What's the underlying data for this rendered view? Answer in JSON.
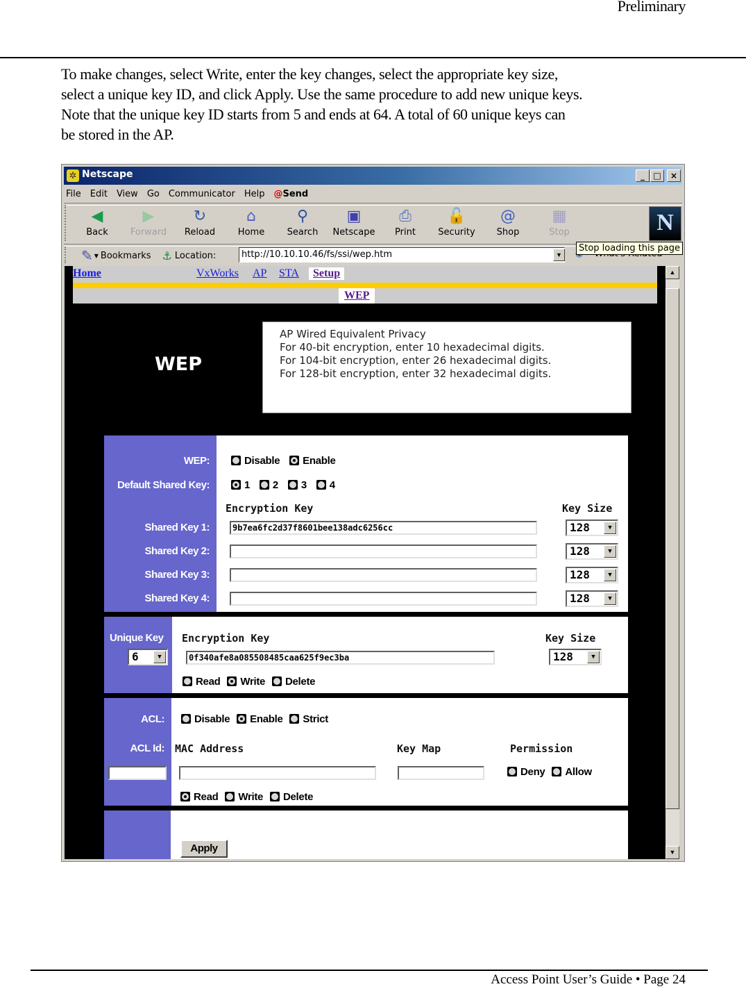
{
  "page_header": {
    "label": "Preliminary"
  },
  "intro": {
    "lines": [
      "To make changes, select Write, enter the key changes, select the appropriate key size,",
      "select a unique key ID, and click Apply. Use the same procedure to add new unique keys.",
      "Note that the unique key ID starts from 5 and ends at 64.  A total of 60 unique keys can",
      "be stored in the AP."
    ]
  },
  "browser": {
    "title": "Netscape",
    "window_controls": {
      "minimize": "_",
      "maximize": "□",
      "close": "×"
    },
    "menu": [
      "File",
      "Edit",
      "View",
      "Go",
      "Communicator",
      "Help"
    ],
    "send_label": "Send",
    "toolbar": [
      {
        "label": "Back",
        "icon": "back-icon",
        "glyph": "◀",
        "color": "#1a9a4a",
        "disabled": false
      },
      {
        "label": "Forward",
        "icon": "forward-icon",
        "glyph": "▶",
        "color": "#9ac8a0",
        "disabled": true
      },
      {
        "label": "Reload",
        "icon": "reload-icon",
        "glyph": "↻",
        "color": "#3a5aa0",
        "disabled": false
      },
      {
        "label": "Home",
        "icon": "home-icon",
        "glyph": "⌂",
        "color": "#5060c0",
        "disabled": false
      },
      {
        "label": "Search",
        "icon": "search-icon",
        "glyph": "⚲",
        "color": "#3050a0",
        "disabled": false
      },
      {
        "label": "Netscape",
        "icon": "my-netscape-icon",
        "glyph": "▣",
        "color": "#4040b0",
        "disabled": false
      },
      {
        "label": "Print",
        "icon": "print-icon",
        "glyph": "⎙",
        "color": "#5070c0",
        "disabled": false
      },
      {
        "label": "Security",
        "icon": "security-lock-icon",
        "glyph": "🔓",
        "color": "#a04020",
        "disabled": false
      },
      {
        "label": "Shop",
        "icon": "shop-bag-icon",
        "glyph": "@",
        "color": "#4060c0",
        "disabled": false
      },
      {
        "label": "Stop",
        "icon": "stop-icon",
        "glyph": "▦",
        "color": "#a0a0c0",
        "disabled": true
      }
    ],
    "netscape_logo": "N",
    "bookmarks_label": "Bookmarks",
    "location_label": "Location:",
    "location_url": "http://10.10.10.46/fs/ssi/wep.htm",
    "whats_related_label": "What's Related",
    "tooltip": "Stop loading this page"
  },
  "webpage": {
    "nav": {
      "home": "Home",
      "items": [
        "VxWorks",
        "AP",
        "STA",
        "Setup"
      ],
      "active": "Setup",
      "sub_item": "WEP"
    },
    "colors": {
      "sidebar_purple": "#6666cc",
      "nav_yellow": "#ffcc00",
      "nav_grey": "#cccccc"
    },
    "heading": "WEP",
    "info": [
      "AP Wired Equivalent Privacy",
      "For 40-bit encryption, enter 10 hexadecimal digits.",
      "For 104-bit encryption, enter 26 hexadecimal digits.",
      "For 128-bit encryption, enter 32 hexadecimal digits."
    ],
    "wep_section": {
      "wep_label": "WEP:",
      "wep_options": [
        {
          "label": "Disable",
          "checked": false
        },
        {
          "label": "Enable",
          "checked": true
        }
      ],
      "default_key_label": "Default Shared Key:",
      "default_key_options": [
        {
          "label": "1",
          "checked": true
        },
        {
          "label": "2",
          "checked": false
        },
        {
          "label": "3",
          "checked": false
        },
        {
          "label": "4",
          "checked": false
        }
      ],
      "encryption_key_header": "Encryption Key",
      "key_size_header": "Key Size",
      "shared_keys": [
        {
          "label": "Shared Key 1:",
          "value": "9b7ea6fc2d37f8601bee138adc6256cc",
          "size": "128"
        },
        {
          "label": "Shared Key 2:",
          "value": "",
          "size": "128"
        },
        {
          "label": "Shared Key 3:",
          "value": "",
          "size": "128"
        },
        {
          "label": "Shared Key 4:",
          "value": "",
          "size": "128"
        }
      ]
    },
    "unique_section": {
      "label": "Unique Key",
      "key_id": "6",
      "encryption_key_header": "Encryption Key",
      "key_size_header": "Key Size",
      "key_value": "0f340afe8a085508485caa625f9ec3ba",
      "key_size": "128",
      "actions": [
        {
          "label": "Read",
          "checked": false
        },
        {
          "label": "Write",
          "checked": true
        },
        {
          "label": "Delete",
          "checked": false
        }
      ]
    },
    "acl_section": {
      "acl_label": "ACL:",
      "acl_options": [
        {
          "label": "Disable",
          "checked": false
        },
        {
          "label": "Enable",
          "checked": true
        },
        {
          "label": "Strict",
          "checked": false
        }
      ],
      "acl_id_label": "ACL Id:",
      "acl_id_value": "",
      "mac_header": "MAC Address",
      "mac_value": "",
      "keymap_header": "Key Map",
      "keymap_value": "",
      "permission_header": "Permission",
      "permission_options": [
        {
          "label": "Deny",
          "checked": false
        },
        {
          "label": "Allow",
          "checked": false
        }
      ],
      "actions": [
        {
          "label": "Read",
          "checked": true
        },
        {
          "label": "Write",
          "checked": false
        },
        {
          "label": "Delete",
          "checked": false
        }
      ]
    },
    "apply_label": "Apply"
  },
  "page_footer": {
    "label": "Access Point User’s Guide   • Page 24"
  }
}
